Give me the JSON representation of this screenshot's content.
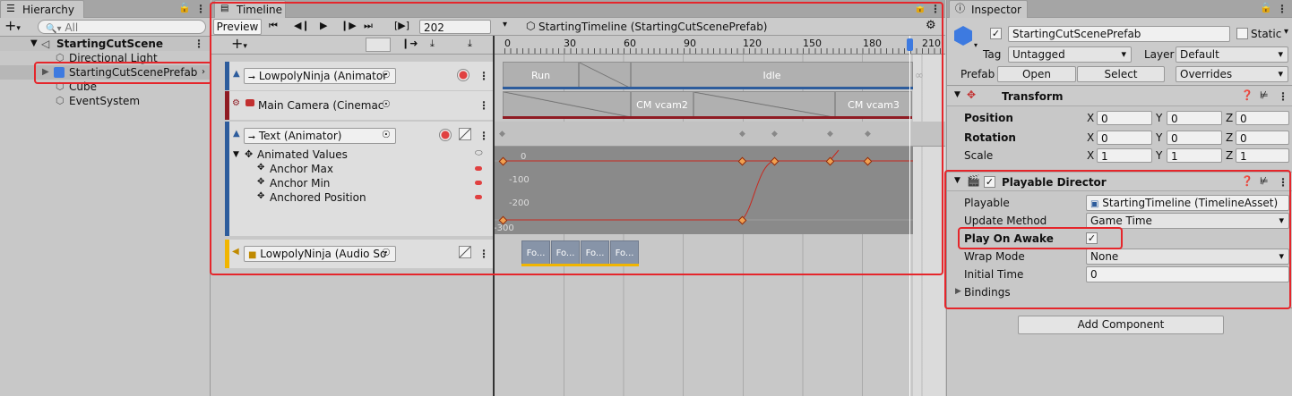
{
  "hierarchy": {
    "tab": "Hierarchy",
    "search_placeholder": "All",
    "scene": "StartingCutScene",
    "items": [
      "Directional Light",
      "StartingCutScenePrefab",
      "Cube",
      "EventSystem"
    ]
  },
  "timeline": {
    "tab": "Timeline",
    "preview_label": "Preview",
    "frame_value": "202",
    "asset_label": "StartingTimeline (StartingCutScenePrefab)",
    "ruler_ticks": [
      "0",
      "30",
      "60",
      "90",
      "120",
      "150",
      "180",
      "210"
    ],
    "tracks": [
      {
        "name": "LowpolyNinja (Animator",
        "clips": [
          "Run",
          "Idle"
        ]
      },
      {
        "name": "Main Camera (Cinemac",
        "clips": [
          "CM vcam2",
          "CM vcam3"
        ]
      },
      {
        "name": "Text (Animator)",
        "group": "Animated Values",
        "properties": [
          "Anchor Max",
          "Anchor Min",
          "Anchored Position"
        ],
        "curve_axis": [
          "0",
          "-100",
          "-200",
          "-300"
        ]
      },
      {
        "name": "LowpolyNinja (Audio So",
        "clips": [
          "Fo...",
          "Fo...",
          "Fo...",
          "Fo..."
        ]
      }
    ]
  },
  "inspector": {
    "tab": "Inspector",
    "object_name": "StartingCutScenePrefab",
    "static_label": "Static",
    "tag_label": "Tag",
    "tag_value": "Untagged",
    "layer_label": "Layer",
    "layer_value": "Default",
    "prefab_label": "Prefab",
    "open_label": "Open",
    "select_label": "Select",
    "overrides_label": "Overrides",
    "transform": {
      "title": "Transform",
      "rows": [
        {
          "label": "Position",
          "x": "0",
          "y": "0",
          "z": "0"
        },
        {
          "label": "Rotation",
          "x": "0",
          "y": "0",
          "z": "0"
        },
        {
          "label": "Scale",
          "x": "1",
          "y": "1",
          "z": "1"
        }
      ]
    },
    "director": {
      "title": "Playable Director",
      "playable_label": "Playable",
      "playable_value": "StartingTimeline (TimelineAsset)",
      "update_label": "Update Method",
      "update_value": "Game Time",
      "awake_label": "Play On Awake",
      "awake_checked": true,
      "wrap_label": "Wrap Mode",
      "wrap_value": "None",
      "initial_label": "Initial Time",
      "initial_value": "0",
      "bindings_label": "Bindings"
    },
    "add_component_label": "Add Component"
  },
  "colors": {
    "highlight": "#e5262b",
    "selection": "#3d7ae0",
    "anim_track": "#2d5c9c",
    "camera_track": "#8f1b23",
    "audio_track": "#f1b500",
    "curve": "#c8281e"
  }
}
